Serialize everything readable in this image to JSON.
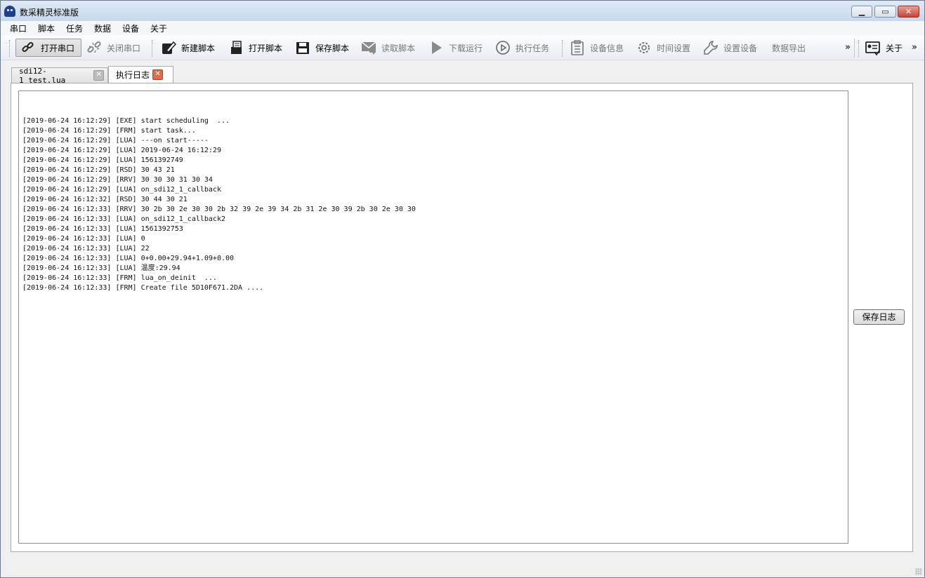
{
  "window": {
    "title": "数采精灵标准版"
  },
  "menu": [
    "串口",
    "脚本",
    "任务",
    "数据",
    "设备",
    "关于"
  ],
  "toolbar": {
    "open_port": "打开串口",
    "close_port": "关闭串口",
    "new_script": "新建脚本",
    "open_script": "打开脚本",
    "save_script": "保存脚本",
    "read_script": "读取脚本",
    "download_run": "下载运行",
    "execute_task": "执行任务",
    "device_info": "设备信息",
    "time_settings": "时间设置",
    "set_device": "设置设备",
    "data_export": "数据导出",
    "overflow": "»",
    "about": "关于",
    "overflow2": "»"
  },
  "tabs": [
    {
      "label": "sdi12-1_test.lua",
      "close": "✕"
    },
    {
      "label": "执行日志",
      "close": "✕"
    }
  ],
  "log": [
    "[2019-06-24 16:12:29] [EXE] start scheduling  ...",
    "[2019-06-24 16:12:29] [FRM] start task...",
    "[2019-06-24 16:12:29] [LUA] ---on start-----",
    "[2019-06-24 16:12:29] [LUA] 2019-06-24 16:12:29",
    "[2019-06-24 16:12:29] [LUA] 1561392749",
    "[2019-06-24 16:12:29] [RSD] 30 43 21",
    "[2019-06-24 16:12:29] [RRV] 30 30 30 31 30 34",
    "[2019-06-24 16:12:29] [LUA] on_sdi12_1_callback",
    "[2019-06-24 16:12:32] [RSD] 30 44 30 21",
    "[2019-06-24 16:12:33] [RRV] 30 2b 30 2e 30 30 2b 32 39 2e 39 34 2b 31 2e 30 39 2b 30 2e 30 30",
    "[2019-06-24 16:12:33] [LUA] on_sdi12_1_callback2",
    "[2019-06-24 16:12:33] [LUA] 1561392753",
    "[2019-06-24 16:12:33] [LUA] 0",
    "[2019-06-24 16:12:33] [LUA] 22",
    "[2019-06-24 16:12:33] [LUA] 0+0.00+29.94+1.09+0.00",
    "[2019-06-24 16:12:33] [LUA] 温度:29.94",
    "[2019-06-24 16:12:33] [FRM] lua_on_deinit  ...",
    "[2019-06-24 16:12:33] [FRM] Create file 5D10F671.2DA ...."
  ],
  "save_log_button": "保存日志"
}
